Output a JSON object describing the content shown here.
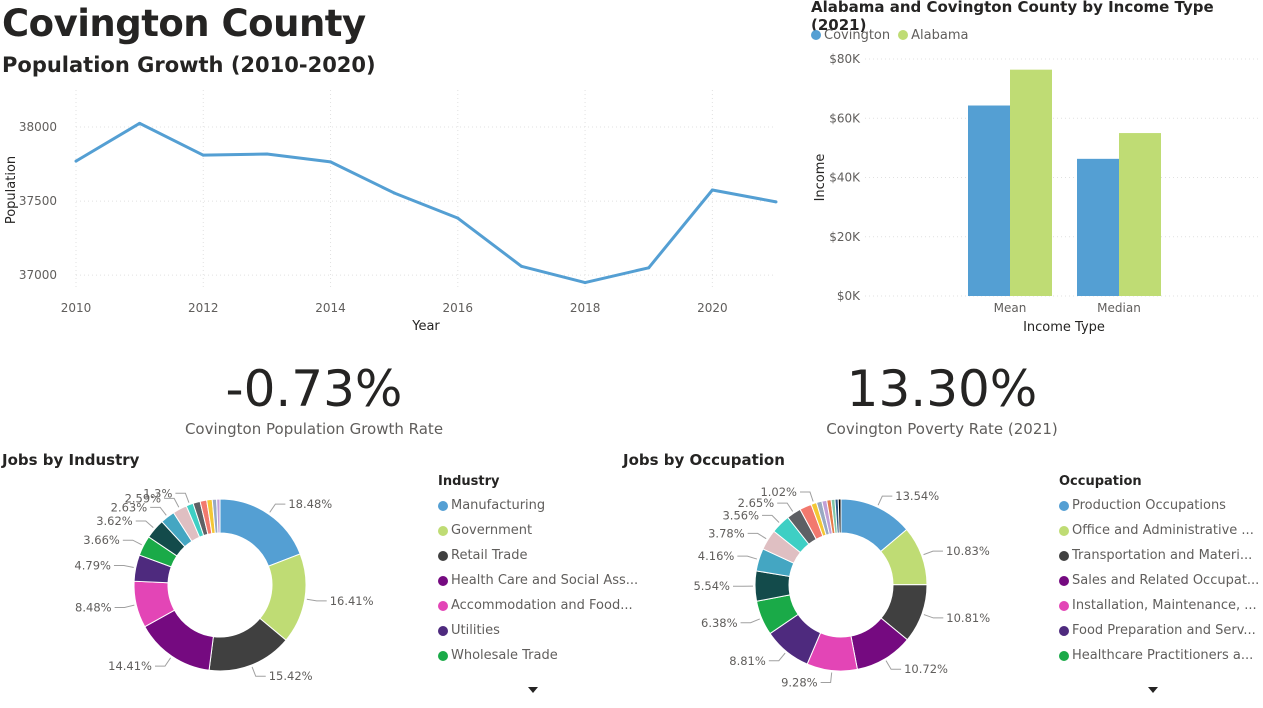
{
  "page": {
    "title": "Covington County",
    "population_title": "Population Growth (2010-2020)"
  },
  "chart_data": [
    {
      "type": "line",
      "id": "population",
      "title": "Population Growth (2010-2020)",
      "xlabel": "Year",
      "ylabel": "Population",
      "x": [
        2010,
        2011,
        2012,
        2013,
        2014,
        2015,
        2016,
        2017,
        2018,
        2019,
        2020,
        2021
      ],
      "values": [
        37770,
        38025,
        37810,
        37818,
        37765,
        37555,
        37385,
        37060,
        36950,
        37050,
        37575,
        37495
      ],
      "x_ticks": [
        2010,
        2012,
        2014,
        2016,
        2018,
        2020
      ],
      "y_ticks": [
        37000,
        37500,
        38000
      ],
      "xlim": [
        2010,
        2021
      ],
      "ylim": [
        36900,
        38250
      ],
      "color": "#549FD3",
      "grid": true
    },
    {
      "type": "bar",
      "id": "income",
      "title": "Alabama and Covington County by Income Type (2021)",
      "xlabel": "Income Type",
      "ylabel": "Income",
      "categories": [
        "Mean",
        "Median"
      ],
      "series": [
        {
          "name": "Covington",
          "color": "#549FD3",
          "values": [
            64300,
            46300
          ]
        },
        {
          "name": "Alabama",
          "color": "#BFDC74",
          "values": [
            76400,
            55000
          ]
        }
      ],
      "y_ticks": [
        0,
        20000,
        40000,
        60000,
        80000
      ],
      "y_tick_labels": [
        "$0K",
        "$20K",
        "$40K",
        "$60K",
        "$80K"
      ],
      "ylim": [
        0,
        80000
      ],
      "legend": "top-left",
      "grid": true
    },
    {
      "type": "pie",
      "id": "industry",
      "title": "Jobs by Industry",
      "legend_title": "Industry",
      "slices": [
        {
          "label": "Manufacturing",
          "value": 18.48,
          "color": "#549FD3",
          "pct": "18.48%"
        },
        {
          "label": "Government",
          "value": 16.41,
          "color": "#BFDC74",
          "pct": "16.41%"
        },
        {
          "label": "Retail Trade",
          "value": 15.42,
          "color": "#404040",
          "pct": "15.42%"
        },
        {
          "label": "Health Care and Social Ass...",
          "value": 14.41,
          "color": "#750A80",
          "pct": "14.41%"
        },
        {
          "label": "Accommodation and Food...",
          "value": 8.48,
          "color": "#E345B6",
          "pct": "8.48%"
        },
        {
          "label": "Utilities",
          "value": 4.79,
          "color": "#4E2A7E",
          "pct": "4.79%"
        },
        {
          "label": "Wholesale Trade",
          "value": 3.66,
          "color": "#1AAA48",
          "pct": "3.66%"
        },
        {
          "label": "",
          "value": 3.62,
          "color": "#134B4B",
          "pct": "3.62%"
        },
        {
          "label": "",
          "value": 2.63,
          "color": "#44A6C2",
          "pct": "2.63%"
        },
        {
          "label": "",
          "value": 2.59,
          "color": "#DFBFC2",
          "pct": "2.59%"
        },
        {
          "label": "",
          "value": 1.3,
          "color": "#3ECFC4",
          "pct": "1.3%"
        },
        {
          "label": "",
          "value": 1.3,
          "color": "#5E6064",
          "pct": ""
        },
        {
          "label": "",
          "value": 1.2,
          "color": "#F2796E",
          "pct": ""
        },
        {
          "label": "",
          "value": 1.0,
          "color": "#F3C735",
          "pct": ""
        },
        {
          "label": "",
          "value": 0.8,
          "color": "#98A9C2",
          "pct": ""
        },
        {
          "label": "",
          "value": 0.6,
          "color": "#C19FD6",
          "pct": ""
        }
      ]
    },
    {
      "type": "pie",
      "id": "occupation",
      "title": "Jobs by Occupation",
      "legend_title": "Occupation",
      "slices": [
        {
          "label": "Production Occupations",
          "value": 13.54,
          "color": "#549FD3",
          "pct": "13.54%"
        },
        {
          "label": "Office and Administrative ...",
          "value": 10.83,
          "color": "#BFDC74",
          "pct": "10.83%"
        },
        {
          "label": "Transportation and Materi...",
          "value": 10.81,
          "color": "#404040",
          "pct": "10.81%"
        },
        {
          "label": "Sales and Related Occupat...",
          "value": 10.72,
          "color": "#750A80",
          "pct": "10.72%"
        },
        {
          "label": "Installation, Maintenance, ...",
          "value": 9.28,
          "color": "#E345B6",
          "pct": "9.28%"
        },
        {
          "label": "Food Preparation and Serv...",
          "value": 8.81,
          "color": "#4E2A7E",
          "pct": "8.81%"
        },
        {
          "label": "Healthcare Practitioners a...",
          "value": 6.38,
          "color": "#1AAA48",
          "pct": "6.38%"
        },
        {
          "label": "",
          "value": 5.54,
          "color": "#134B4B",
          "pct": "5.54%"
        },
        {
          "label": "",
          "value": 4.16,
          "color": "#44A6C2",
          "pct": "4.16%"
        },
        {
          "label": "",
          "value": 3.78,
          "color": "#DFBFC2",
          "pct": "3.78%"
        },
        {
          "label": "",
          "value": 3.56,
          "color": "#3ECFC4",
          "pct": "3.56%"
        },
        {
          "label": "",
          "value": 2.65,
          "color": "#5E6064",
          "pct": "2.65%"
        },
        {
          "label": "",
          "value": 2.2,
          "color": "#F2796E",
          "pct": ""
        },
        {
          "label": "",
          "value": 1.02,
          "color": "#F3C735",
          "pct": "1.02%"
        },
        {
          "label": "",
          "value": 1.0,
          "color": "#98A9C2",
          "pct": ""
        },
        {
          "label": "",
          "value": 0.9,
          "color": "#C19FD6",
          "pct": ""
        },
        {
          "label": "",
          "value": 0.8,
          "color": "#E67C4A",
          "pct": ""
        },
        {
          "label": "",
          "value": 0.7,
          "color": "#7FC7A9",
          "pct": ""
        },
        {
          "label": "",
          "value": 0.6,
          "color": "#2E5C8A",
          "pct": ""
        },
        {
          "label": "",
          "value": 0.5,
          "color": "#000000",
          "pct": ""
        }
      ]
    }
  ],
  "kpis": [
    {
      "value": "-0.73%",
      "label": "Covington Population Growth Rate"
    },
    {
      "value": "13.30%",
      "label": "Covington Poverty Rate (2021)"
    }
  ]
}
